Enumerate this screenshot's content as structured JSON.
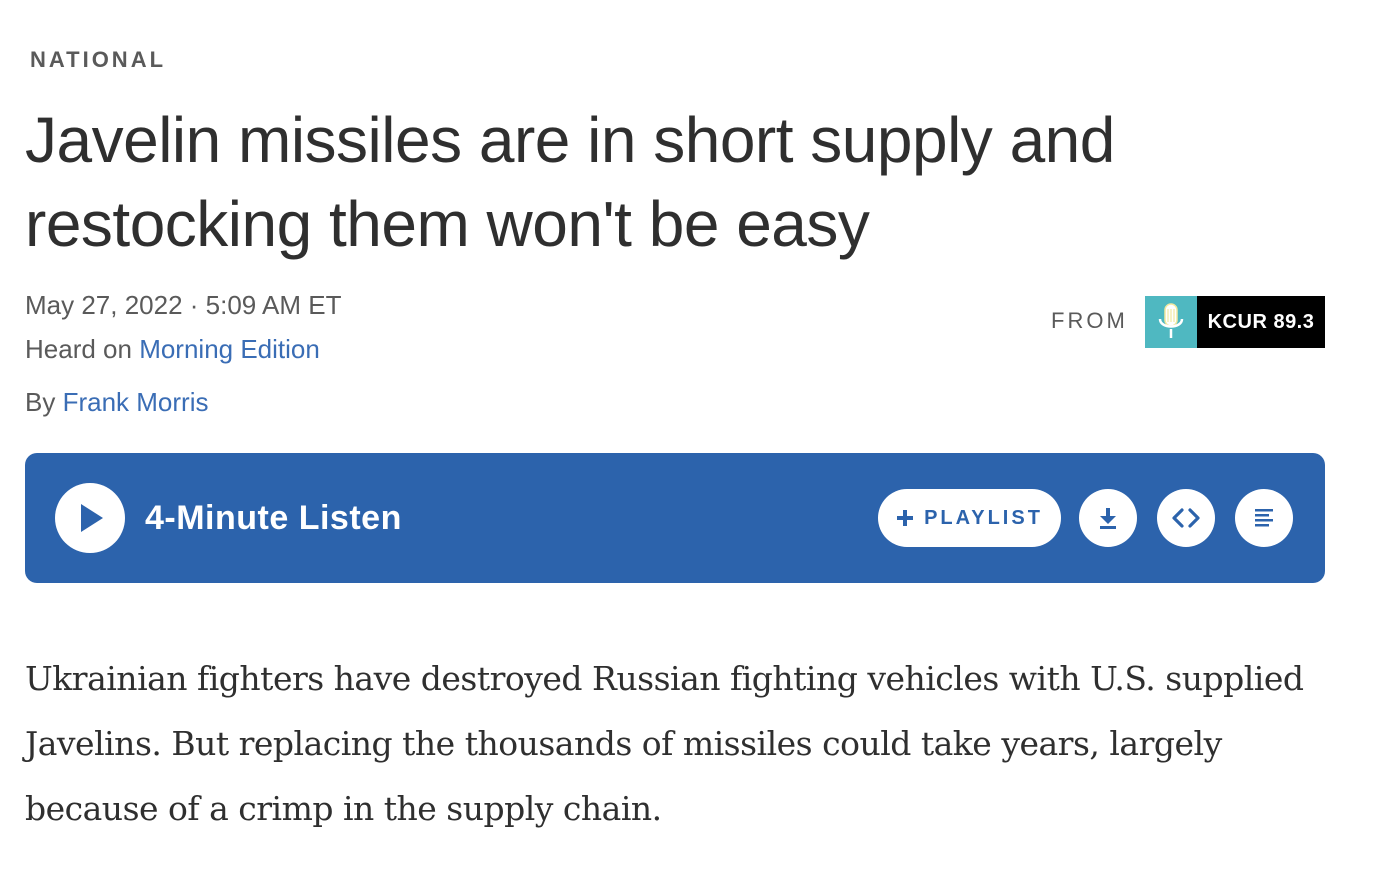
{
  "section": {
    "label": "NATIONAL"
  },
  "article": {
    "headline": "Javelin missiles are in short supply and restocking them won't be easy",
    "dateline": "May 27, 2022 · 5:09 AM ET",
    "heard_prefix": "Heard on ",
    "program": "Morning Edition",
    "by_prefix": "By ",
    "author": "Frank Morris",
    "teaser": "Ukrainian fighters have destroyed Russian fighting vehicles with U.S. supplied Javelins. But replacing the thousands of missiles could take years, largely because of a crimp in the supply chain."
  },
  "station": {
    "from_label": "FROM",
    "name": "KCUR 89.3",
    "icon": "microphone-icon",
    "colors": {
      "mic_bg": "#4fb8c1",
      "name_bg": "#000000"
    }
  },
  "player": {
    "listen_label": "4-Minute Listen",
    "playlist_label": "PLAYLIST",
    "play_icon": "play-icon",
    "download_icon": "download-icon",
    "embed_icon": "embed-icon",
    "transcript_icon": "transcript-icon",
    "colors": {
      "background": "#2c63ac",
      "button": "#ffffff"
    }
  },
  "colors": {
    "link": "#3a6db5",
    "text": "#2f2f2f",
    "meta": "#5a5a5a"
  }
}
